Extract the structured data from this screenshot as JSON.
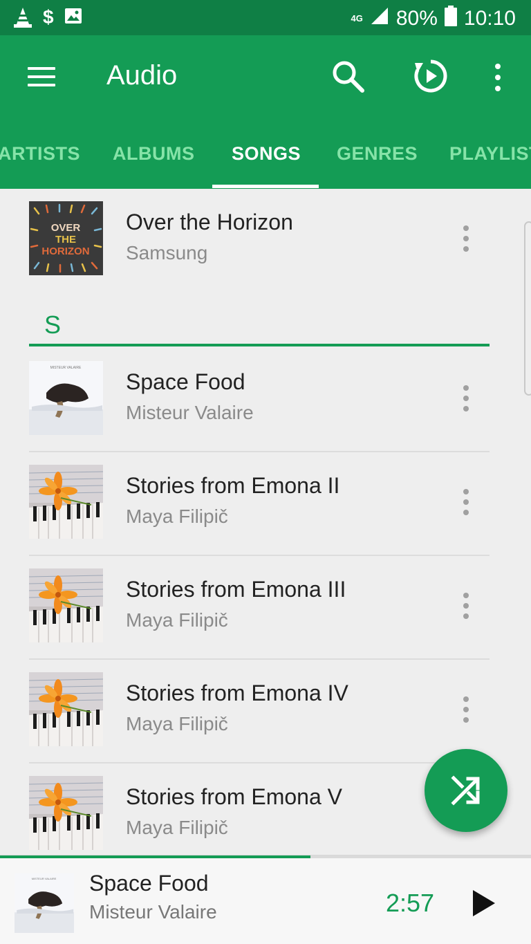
{
  "status_bar": {
    "network": "4G",
    "battery": "80%",
    "time": "10:10",
    "icons": [
      "vlc-cone-icon",
      "dollar-icon",
      "image-icon",
      "signal-icon",
      "battery-icon"
    ]
  },
  "app_bar": {
    "title": "Audio",
    "accent_color": "#149c55",
    "status_color": "#0f7f45"
  },
  "tabs": [
    {
      "label": "ARTISTS",
      "active": false
    },
    {
      "label": "ALBUMS",
      "active": false
    },
    {
      "label": "SONGS",
      "active": true
    },
    {
      "label": "GENRES",
      "active": false
    },
    {
      "label": "PLAYLISTS",
      "active": false
    }
  ],
  "list": {
    "first_song": {
      "title": "Over the Horizon",
      "artist": "Samsung"
    },
    "section_letter": "S",
    "songs": [
      {
        "title": "Space Food",
        "artist": "Misteur Valaire"
      },
      {
        "title": "Stories from Emona II",
        "artist": "Maya Filipič"
      },
      {
        "title": "Stories from Emona III",
        "artist": "Maya Filipič"
      },
      {
        "title": "Stories from Emona IV",
        "artist": "Maya Filipič"
      },
      {
        "title": "Stories from Emona V",
        "artist": "Maya Filipič"
      }
    ],
    "album_art_text": {
      "horizon": [
        "OVER",
        "THE",
        "HORIZON"
      ],
      "space_food": "MISTEUR VALAIRE"
    }
  },
  "mini_player": {
    "title": "Space Food",
    "artist": "Misteur Valaire",
    "time": "2:57",
    "progress": 0.585
  }
}
